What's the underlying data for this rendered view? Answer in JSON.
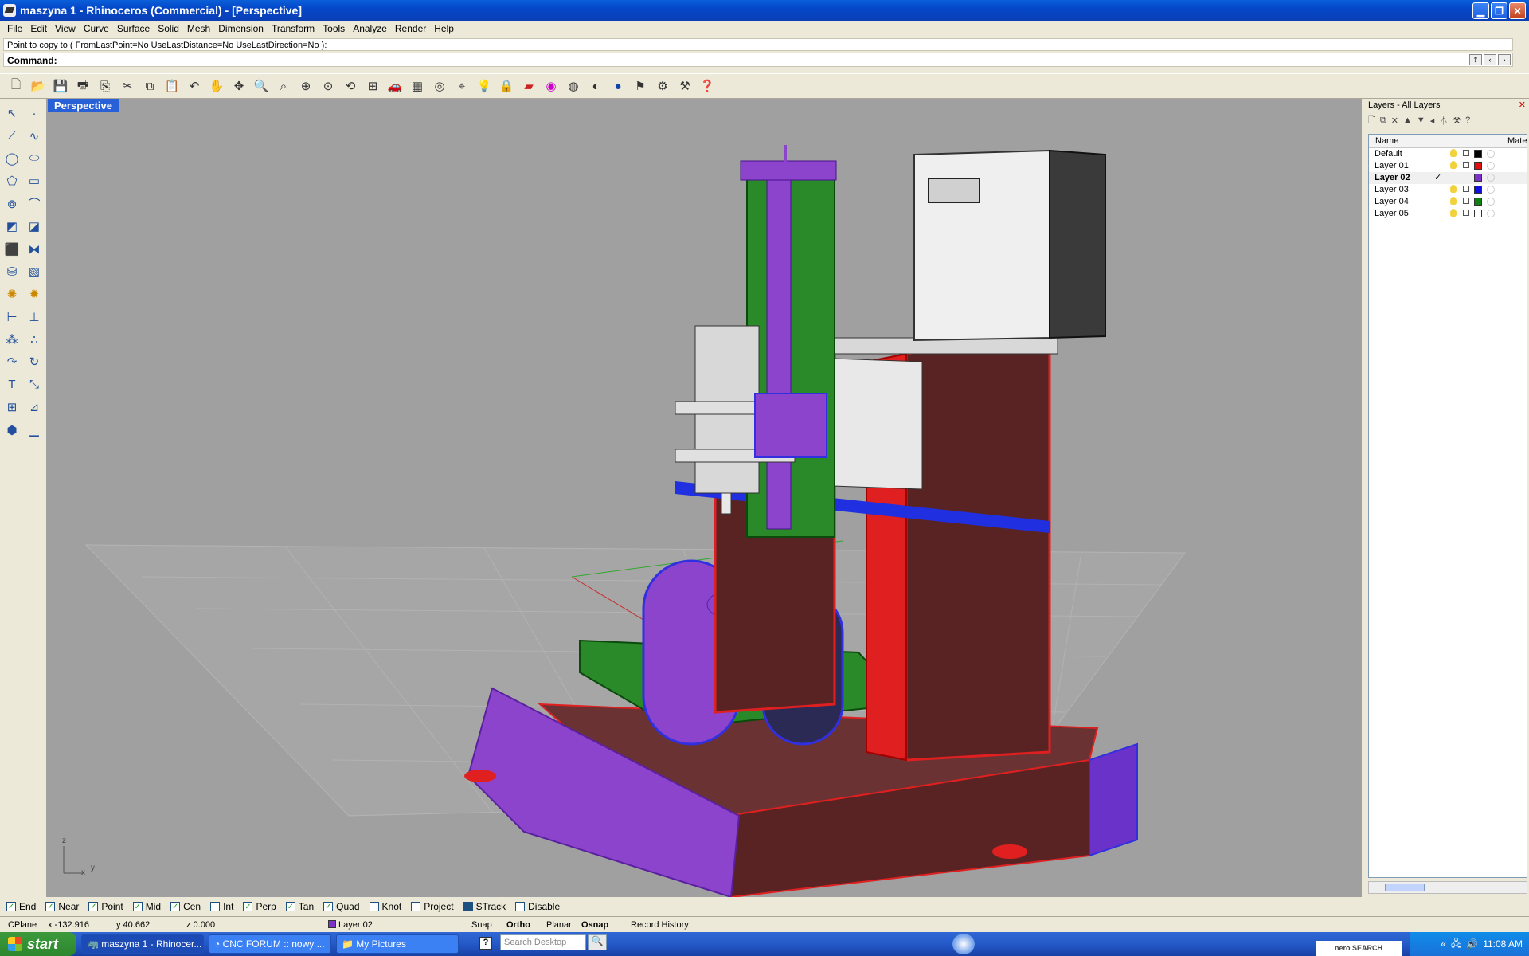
{
  "window": {
    "title": "maszyna 1 - Rhinoceros (Commercial) - [Perspective]"
  },
  "menu": [
    "File",
    "Edit",
    "View",
    "Curve",
    "Surface",
    "Solid",
    "Mesh",
    "Dimension",
    "Transform",
    "Tools",
    "Analyze",
    "Render",
    "Help"
  ],
  "command": {
    "history": "Point to copy to ( FromLastPoint=No  UseLastDistance=No  UseLastDirection=No ):",
    "prompt": "Command:"
  },
  "toolbar_icons": [
    "new-icon",
    "open-icon",
    "save-icon",
    "print-icon",
    "import-icon",
    "cut-icon",
    "copy-icon",
    "paste-icon",
    "undo-icon",
    "pan-icon",
    "rotate-view-icon",
    "zoom-dynamic-icon",
    "zoom-window-icon",
    "zoom-extents-icon",
    "zoom-selected-icon",
    "undo-view-icon",
    "four-viewports-icon",
    "car-icon",
    "grid-plane-icon",
    "cplane-icon",
    "osnap-icon",
    "light-icon",
    "lock-icon",
    "paint-icon",
    "color-wheel-icon",
    "wireframe-icon",
    "shaded-icon",
    "rendered-icon",
    "texture-icon",
    "gear-icon",
    "tools-icon",
    "help-icon"
  ],
  "viewport": {
    "label": "Perspective"
  },
  "layers": {
    "panel_title": "Layers - All Layers",
    "col_name": "Name",
    "col_material": "Mate",
    "items": [
      {
        "name": "Default",
        "color": "#000000",
        "current": false
      },
      {
        "name": "Layer 01",
        "color": "#e01010",
        "current": false
      },
      {
        "name": "Layer 02",
        "color": "#7a32c8",
        "current": true
      },
      {
        "name": "Layer 03",
        "color": "#1010e0",
        "current": false
      },
      {
        "name": "Layer 04",
        "color": "#108010",
        "current": false
      },
      {
        "name": "Layer 05",
        "color": "#ffffff",
        "current": false
      }
    ],
    "check_mark": "✓"
  },
  "osnaps": [
    {
      "label": "End",
      "checked": true
    },
    {
      "label": "Near",
      "checked": true
    },
    {
      "label": "Point",
      "checked": true
    },
    {
      "label": "Mid",
      "checked": true
    },
    {
      "label": "Cen",
      "checked": true
    },
    {
      "label": "Int",
      "checked": false
    },
    {
      "label": "Perp",
      "checked": true
    },
    {
      "label": "Tan",
      "checked": true
    },
    {
      "label": "Quad",
      "checked": true
    },
    {
      "label": "Knot",
      "checked": false
    },
    {
      "label": "Project",
      "checked": false
    },
    {
      "label": "STrack",
      "checked": false
    },
    {
      "label": "Disable",
      "checked": false
    }
  ],
  "status": {
    "cplane": "CPlane",
    "x": "x -132.916",
    "y": "y 40.662",
    "z": "z 0.000",
    "layer": "Layer 02",
    "snap": "Snap",
    "ortho": "Ortho",
    "planar": "Planar",
    "osnap": "Osnap",
    "record_history": "Record History"
  },
  "taskbar": {
    "start": "start",
    "tasks": [
      "maszyna 1 - Rhinocer...",
      "CNC FORUM :: nowy ...",
      "My Pictures"
    ],
    "search_placeholder": "Search Desktop",
    "help": "?",
    "time": "11:08 AM",
    "nero": "nero SEARCH"
  },
  "axes": {
    "x": "x",
    "y": "y",
    "z": "z"
  }
}
